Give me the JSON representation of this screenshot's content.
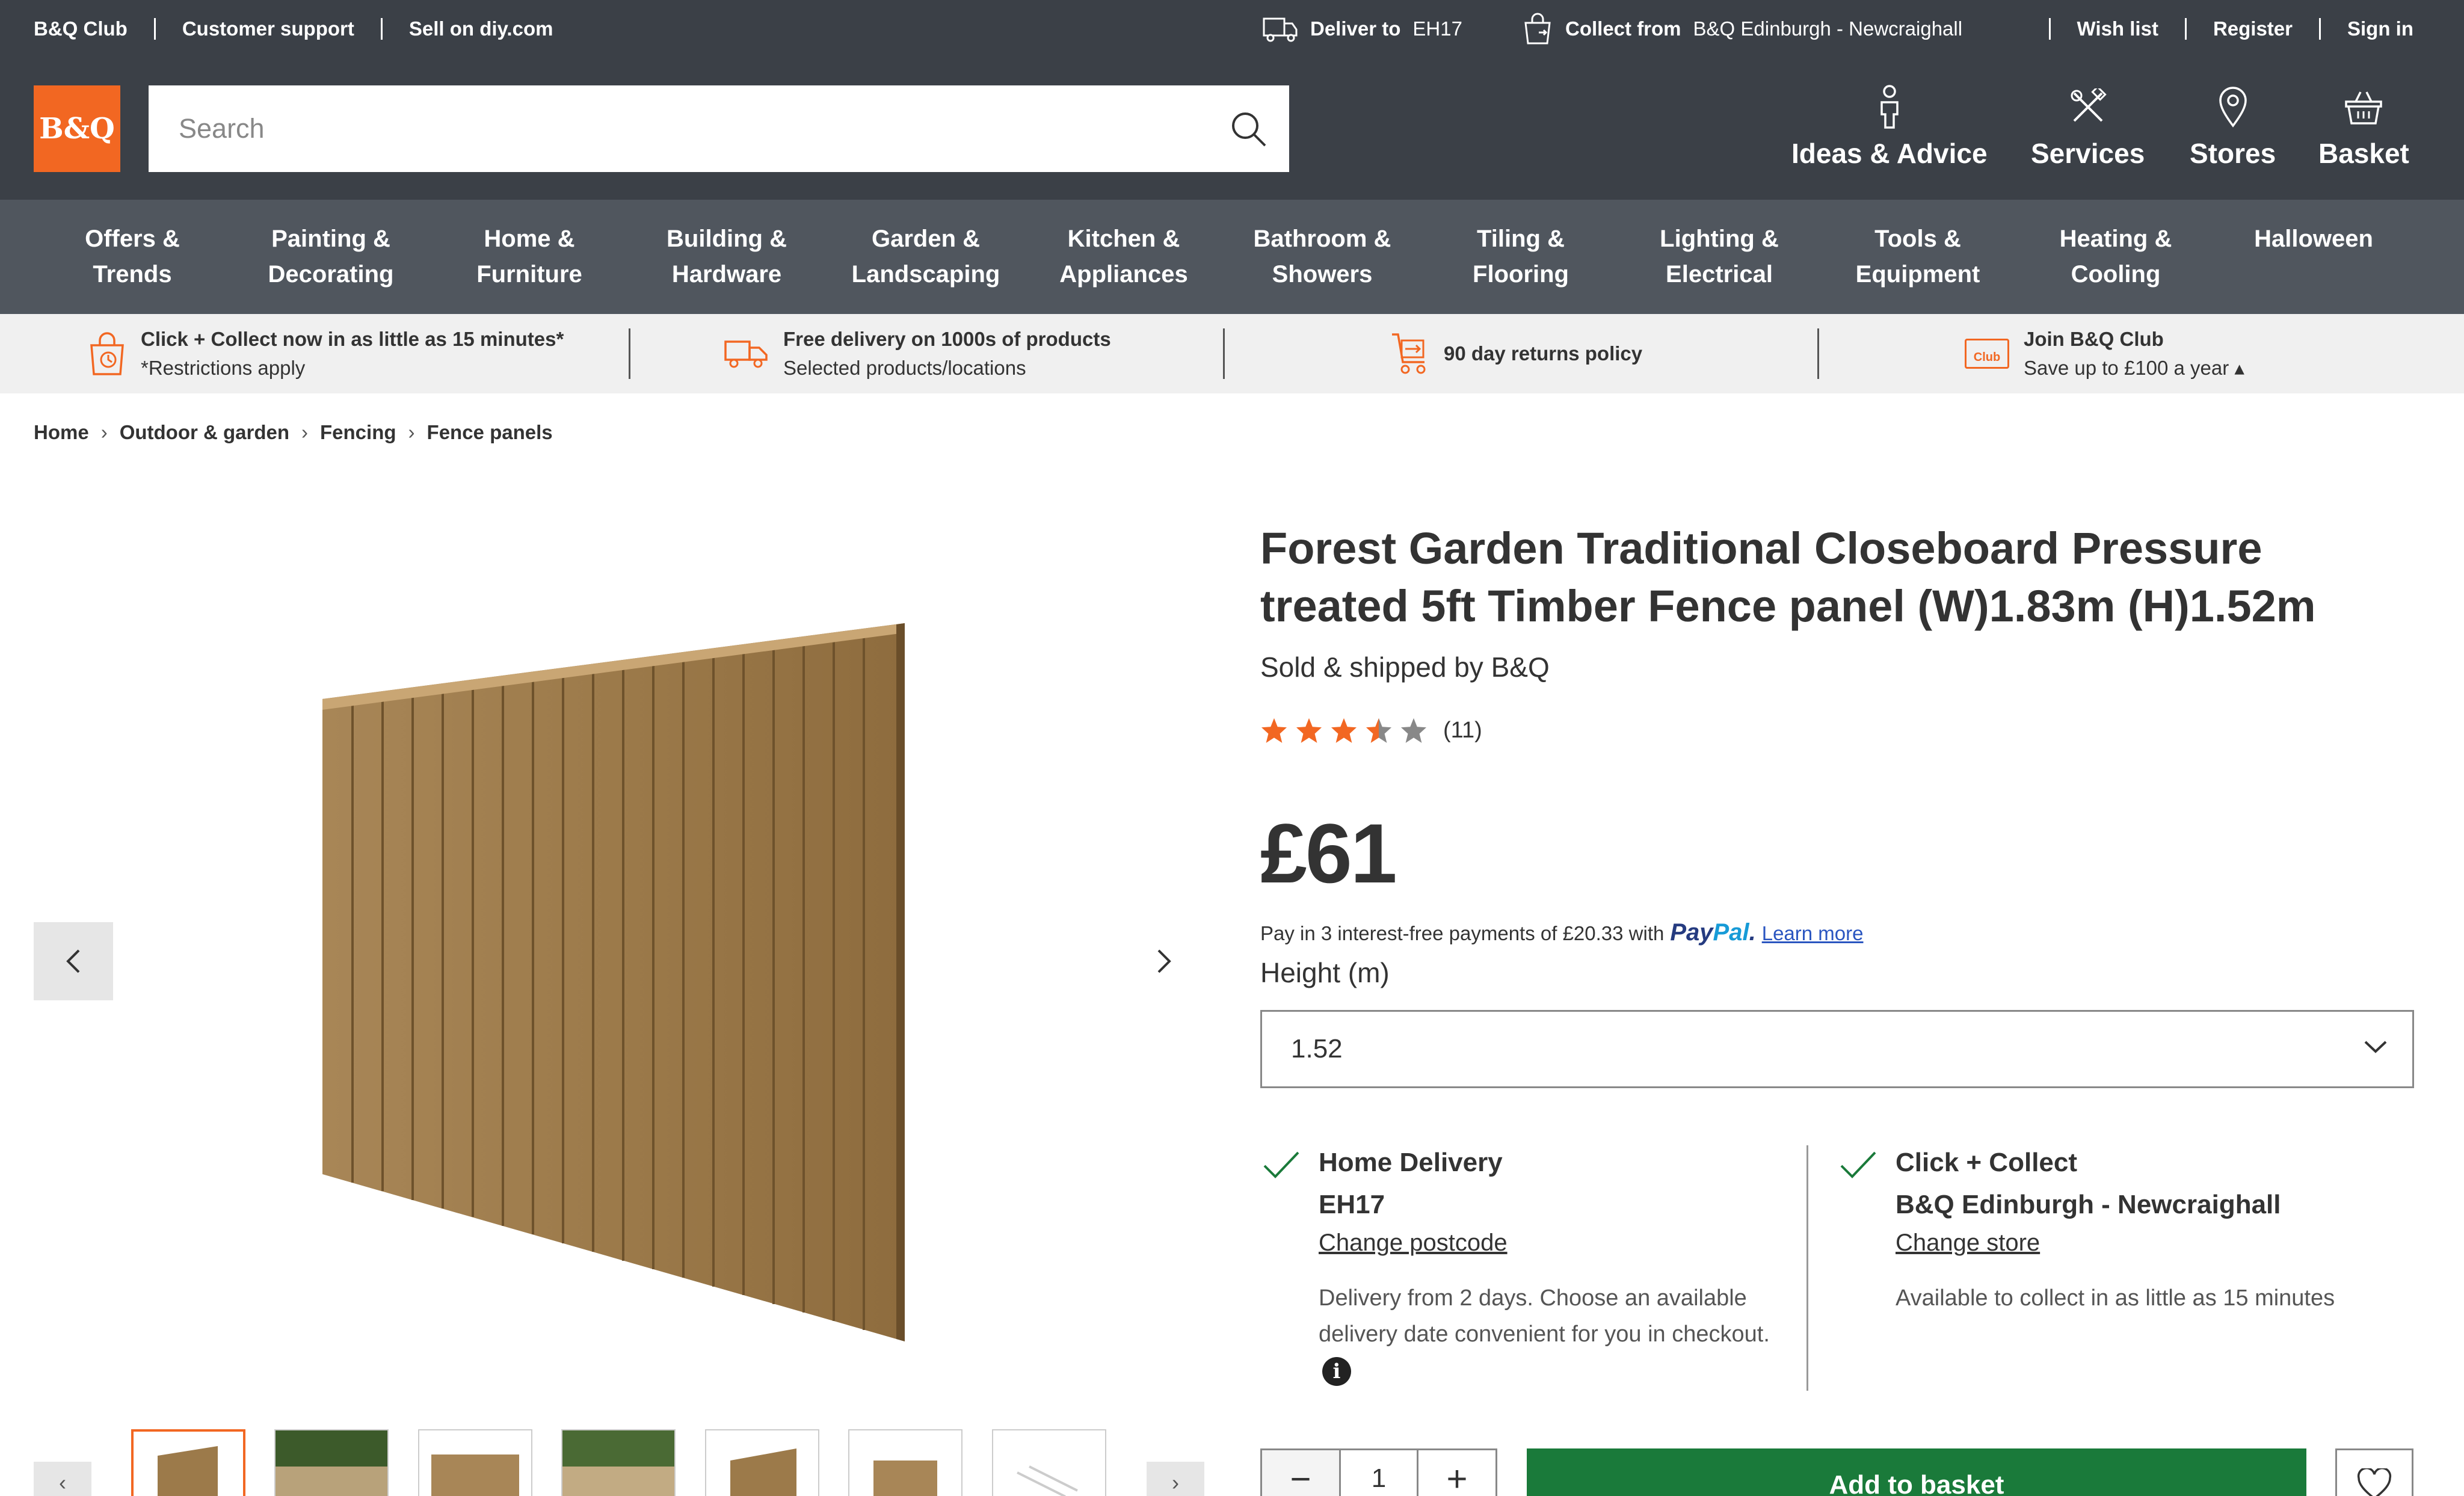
{
  "utility": {
    "club": "B&Q Club",
    "support": "Customer support",
    "sell": "Sell on diy.com",
    "deliver_label": "Deliver to",
    "deliver_postcode": "EH17",
    "collect_label": "Collect from",
    "collect_store": "B&Q Edinburgh - Newcraighall",
    "wishlist": "Wish list",
    "register": "Register",
    "signin": "Sign in"
  },
  "header": {
    "logo": "B&Q",
    "search_placeholder": "Search",
    "nav": {
      "ideas": "Ideas & Advice",
      "services": "Services",
      "stores": "Stores",
      "basket": "Basket"
    }
  },
  "categories": [
    {
      "l1": "Offers &",
      "l2": "Trends"
    },
    {
      "l1": "Painting &",
      "l2": "Decorating"
    },
    {
      "l1": "Home &",
      "l2": "Furniture"
    },
    {
      "l1": "Building &",
      "l2": "Hardware"
    },
    {
      "l1": "Garden &",
      "l2": "Landscaping"
    },
    {
      "l1": "Kitchen &",
      "l2": "Appliances"
    },
    {
      "l1": "Bathroom &",
      "l2": "Showers"
    },
    {
      "l1": "Tiling &",
      "l2": "Flooring"
    },
    {
      "l1": "Lighting &",
      "l2": "Electrical"
    },
    {
      "l1": "Tools &",
      "l2": "Equipment"
    },
    {
      "l1": "Heating &",
      "l2": "Cooling"
    },
    {
      "l1": "Halloween",
      "l2": ""
    }
  ],
  "usp": {
    "collect_title": "Click + Collect now in as little as 15 minutes*",
    "collect_sub": "*Restrictions apply",
    "delivery_title": "Free delivery on 1000s of products",
    "delivery_sub": "Selected products/locations",
    "returns_title": "90 day returns policy",
    "club_title": "Join B&Q Club",
    "club_sub": "Save up to £100 a year ▴",
    "club_badge": "Club"
  },
  "breadcrumb": [
    "Home",
    "Outdoor & garden",
    "Fencing",
    "Fence panels"
  ],
  "product": {
    "title": "Forest Garden Traditional Closeboard Pressure treated 5ft Timber Fence panel (W)1.83m (H)1.52m",
    "sold_by": "Sold & shipped by B&Q",
    "rating": 3.5,
    "review_count": "(11)",
    "price": "£61",
    "paypal_text": "Pay in 3 interest-free payments of £20.33 with",
    "paypal_logo_1": "Pay",
    "paypal_logo_2": "Pal",
    "paypal_dot": ".",
    "learn_more": "Learn more",
    "height_label": "Height (m)",
    "height_value": "1.52"
  },
  "delivery": {
    "home_title": "Home Delivery",
    "home_postcode": "EH17",
    "home_link": "Change postcode",
    "home_note": "Delivery from 2 days. Choose an available delivery date convenient for you in checkout.",
    "collect_title": "Click + Collect",
    "collect_store": "B&Q Edinburgh - Newcraighall",
    "collect_link": "Change store",
    "collect_note": "Available to collect in as little as 15 minutes"
  },
  "actions": {
    "quantity": "1",
    "minus": "−",
    "plus": "+",
    "add_to_basket": "Add to basket"
  },
  "colors": {
    "brand_orange": "#f26722",
    "header_dark": "#3b4047",
    "nav_grey": "#50565e",
    "star": "#f26722",
    "success_green": "#1a7a3a"
  }
}
